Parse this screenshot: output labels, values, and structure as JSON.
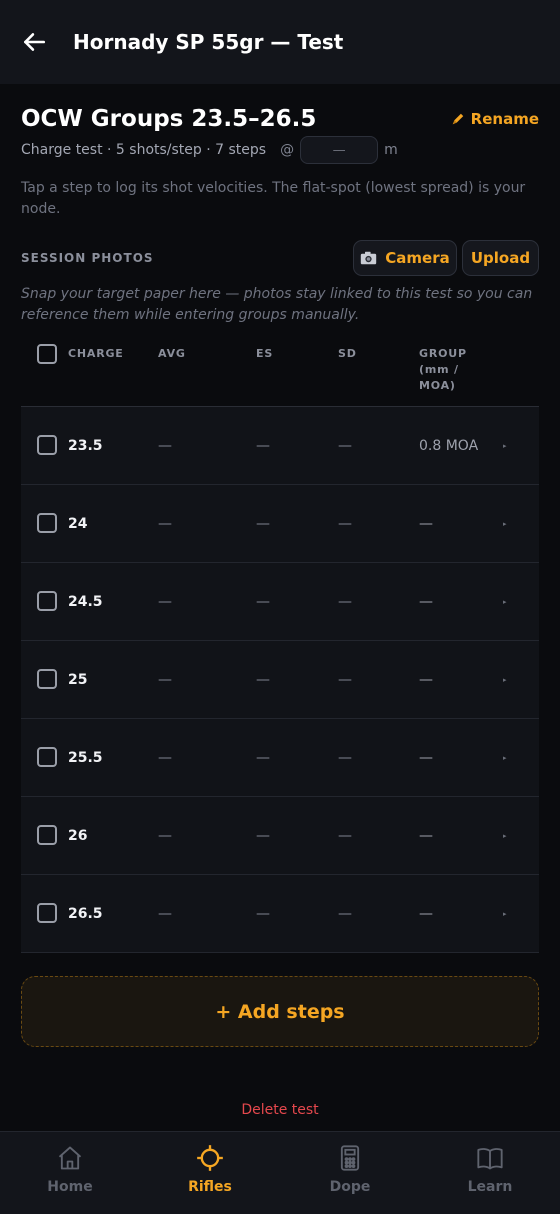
{
  "appbar": {
    "title": "Hornady SP 55gr — Test"
  },
  "header": {
    "title": "OCW Groups 23.5–26.5",
    "rename_label": "Rename",
    "meta": "Charge test · 5 shots/step · 7 steps",
    "at": "@",
    "distance_placeholder": "—",
    "distance_unit": "m",
    "hint": "Tap a step to log its shot velocities. The flat-spot (lowest spread) is your node."
  },
  "photos": {
    "section_label": "SESSION PHOTOS",
    "camera_label": "Camera",
    "upload_label": "Upload",
    "hint": "Snap your target paper here — photos stay linked to this test so you can reference them while entering groups manually."
  },
  "table": {
    "headers": {
      "charge": "CHARGE",
      "avg": "AVG",
      "es": "ES",
      "sd": "SD",
      "group_l1": "GROUP",
      "group_l2": "(mm /",
      "group_l3": "MOA)"
    },
    "rows": [
      {
        "charge": "23.5",
        "avg": "—",
        "es": "—",
        "sd": "—",
        "group": "0.8 MOA",
        "chevron": "▸"
      },
      {
        "charge": "24",
        "avg": "—",
        "es": "—",
        "sd": "—",
        "group": "—",
        "chevron": "▸"
      },
      {
        "charge": "24.5",
        "avg": "—",
        "es": "—",
        "sd": "—",
        "group": "—",
        "chevron": "▸"
      },
      {
        "charge": "25",
        "avg": "—",
        "es": "—",
        "sd": "—",
        "group": "—",
        "chevron": "▸"
      },
      {
        "charge": "25.5",
        "avg": "—",
        "es": "—",
        "sd": "—",
        "group": "—",
        "chevron": "▸"
      },
      {
        "charge": "26",
        "avg": "—",
        "es": "—",
        "sd": "—",
        "group": "—",
        "chevron": "▸"
      },
      {
        "charge": "26.5",
        "avg": "—",
        "es": "—",
        "sd": "—",
        "group": "—",
        "chevron": "▸"
      }
    ]
  },
  "add_steps_label": "+ Add steps",
  "delete_label": "Delete test",
  "nav": {
    "items": [
      {
        "label": "Home",
        "icon": "home-icon"
      },
      {
        "label": "Rifles",
        "icon": "crosshair-icon",
        "active": true
      },
      {
        "label": "Dope",
        "icon": "calculator-icon"
      },
      {
        "label": "Learn",
        "icon": "book-icon"
      }
    ]
  },
  "colors": {
    "accent": "#f5a623",
    "danger": "#e5484d",
    "background": "#0a0b0e",
    "surface": "#13151b"
  }
}
